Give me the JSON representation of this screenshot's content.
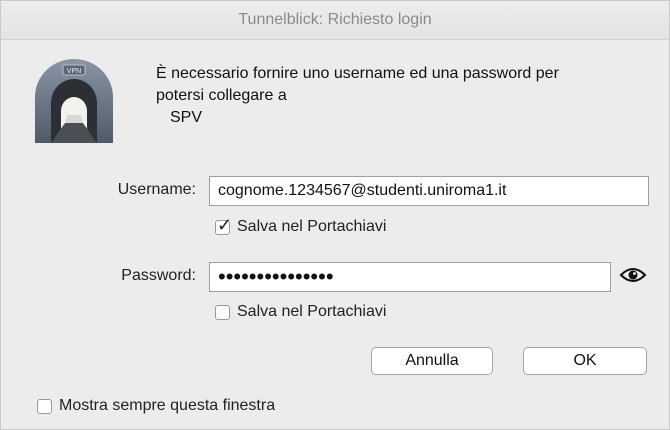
{
  "window": {
    "title": "Tunnelblick: Richiesto login"
  },
  "icon": {
    "name": "vpn-tunnel-icon",
    "badge_text": "VPN"
  },
  "message": {
    "line1": "È necessario fornire uno username ed una password per",
    "line2": "potersi collegare a",
    "connection": "SPV"
  },
  "username": {
    "label": "Username:",
    "value": "cognome.1234567@studenti.uniroma1.it",
    "save_label": "Salva nel Portachiavi",
    "save_checked": true
  },
  "password": {
    "label": "Password:",
    "value": "•••••••••••••••",
    "save_label": "Salva nel Portachiavi",
    "save_checked": false,
    "reveal_icon": "eye-icon"
  },
  "buttons": {
    "cancel": "Annulla",
    "ok": "OK"
  },
  "footer": {
    "always_show_label": "Mostra sempre questa finestra",
    "always_show_checked": false
  }
}
